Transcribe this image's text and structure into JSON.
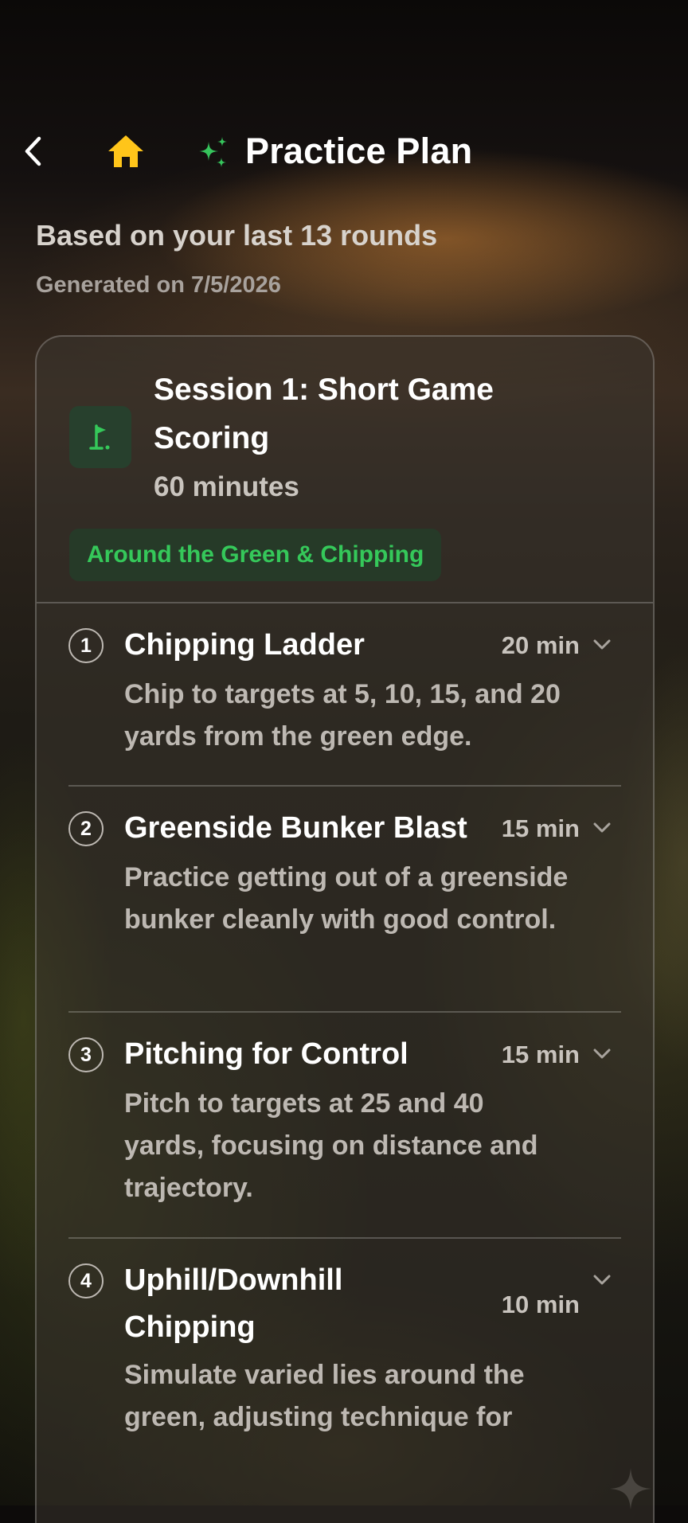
{
  "header": {
    "title": "Practice Plan",
    "back_icon": "chevron-left-icon",
    "home_icon": "home-icon",
    "title_icon": "sparkles-icon",
    "home_color": "#FFC51A",
    "sparkle_color": "#36C45C"
  },
  "summary": {
    "basis": "Based on your last 13 rounds",
    "generated": "Generated on 7/5/2026"
  },
  "session": {
    "title": "Session 1: Short Game Scoring",
    "duration": "60 minutes",
    "focus": "Around the Green & Chipping",
    "icon": "golf-flag-icon",
    "accent_color": "#35C85A",
    "drills": [
      {
        "number": "1",
        "name": "Chipping Ladder",
        "time": "20 min",
        "description": "Chip to targets at 5, 10, 15, and 20 yards from the green edge."
      },
      {
        "number": "2",
        "name": "Greenside Bunker Blast",
        "time": "15 min",
        "description": "Practice getting out of a greenside bunker cleanly with good control."
      },
      {
        "number": "3",
        "name": "Pitching for Control",
        "time": "15 min",
        "description": "Pitch to targets at 25 and 40 yards, focusing on distance and trajectory."
      },
      {
        "number": "4",
        "name": "Uphill/Downhill Chipping",
        "time": "10 min",
        "description": "Simulate varied lies around the green, adjusting technique for"
      }
    ]
  }
}
